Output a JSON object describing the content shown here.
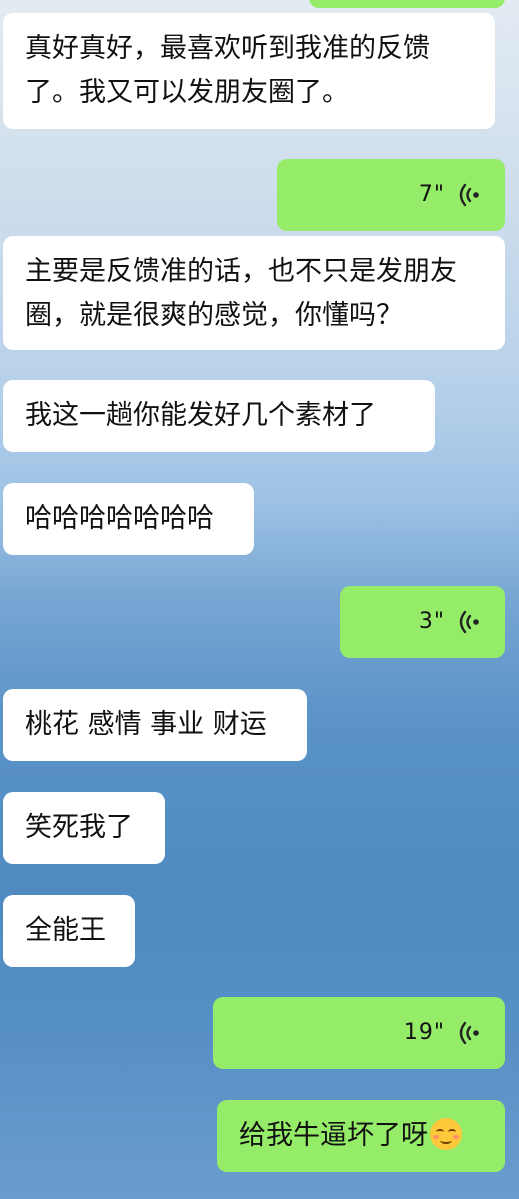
{
  "messages": [
    {
      "side": "in",
      "type": "text",
      "text": "真好真好，最喜欢听到我准的反馈了。我又可以发朋友圈了。"
    },
    {
      "side": "out",
      "type": "voice",
      "duration": "7\""
    },
    {
      "side": "in",
      "type": "text",
      "text": "主要是反馈准的话，也不只是发朋友圈，就是很爽的感觉，你懂吗？"
    },
    {
      "side": "in",
      "type": "text",
      "text": "我这一趟你能发好几个素材了"
    },
    {
      "side": "in",
      "type": "text",
      "text": "哈哈哈哈哈哈哈"
    },
    {
      "side": "out",
      "type": "voice",
      "duration": "3\""
    },
    {
      "side": "in",
      "type": "text",
      "text": "桃花 感情 事业 财运"
    },
    {
      "side": "in",
      "type": "text",
      "text": "笑死我了"
    },
    {
      "side": "in",
      "type": "text",
      "text": "全能王"
    },
    {
      "side": "out",
      "type": "voice",
      "duration": "19\""
    },
    {
      "side": "out",
      "type": "text",
      "text": "给我牛逼坏了呀",
      "emoji": "smirk-emoji"
    }
  ],
  "colors": {
    "outgoing_bubble": "#95ec69",
    "incoming_bubble": "#ffffff"
  }
}
